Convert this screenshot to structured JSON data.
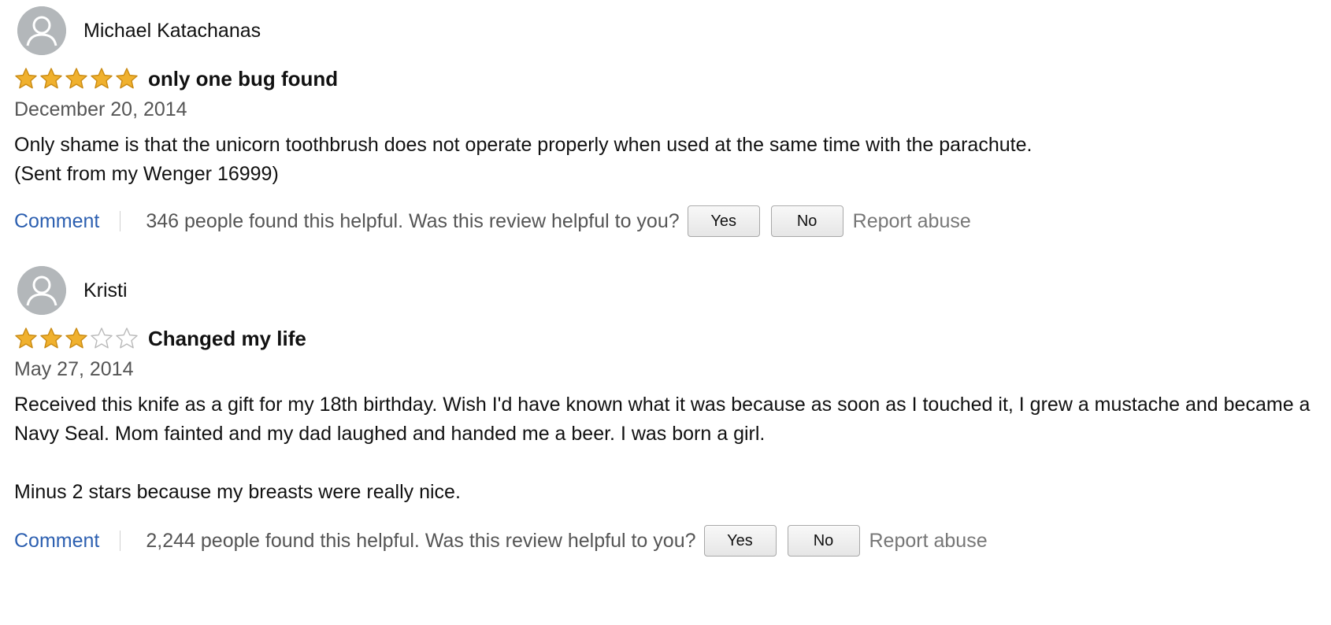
{
  "colors": {
    "star_fill": "#f0b12e",
    "star_stroke": "#c98a12",
    "link": "#2c5fb0",
    "muted_text": "#555555",
    "report_text": "#777777",
    "avatar_bg": "#b3b7ba"
  },
  "reviews": [
    {
      "author": "Michael Katachanas",
      "avatar_icon": "user-silhouette",
      "rating": 5,
      "rating_max": 5,
      "title": "only one bug found",
      "date": "December 20, 2014",
      "body": [
        "Only shame is that the unicorn toothbrush does not operate properly when used at the same time with the parachute.",
        "(Sent from my Wenger 16999)"
      ],
      "comment_label": "Comment",
      "helpful_text": "346 people found this helpful. Was this review helpful to you?",
      "yes_label": "Yes",
      "no_label": "No",
      "report_label": "Report abuse"
    },
    {
      "author": "Kristi",
      "avatar_icon": "user-silhouette",
      "rating": 3,
      "rating_max": 5,
      "title": "Changed my life",
      "date": "May 27, 2014",
      "body": [
        "Received this knife as a gift for my 18th birthday. Wish I'd have known what it was because as soon as I touched it, I grew a mustache and became a Navy Seal. Mom fainted and my dad laughed and handed me a beer. I was born a girl.",
        "Minus 2 stars because my breasts were really nice."
      ],
      "comment_label": "Comment",
      "helpful_text": "2,244 people found this helpful. Was this review helpful to you?",
      "yes_label": "Yes",
      "no_label": "No",
      "report_label": "Report abuse"
    }
  ]
}
